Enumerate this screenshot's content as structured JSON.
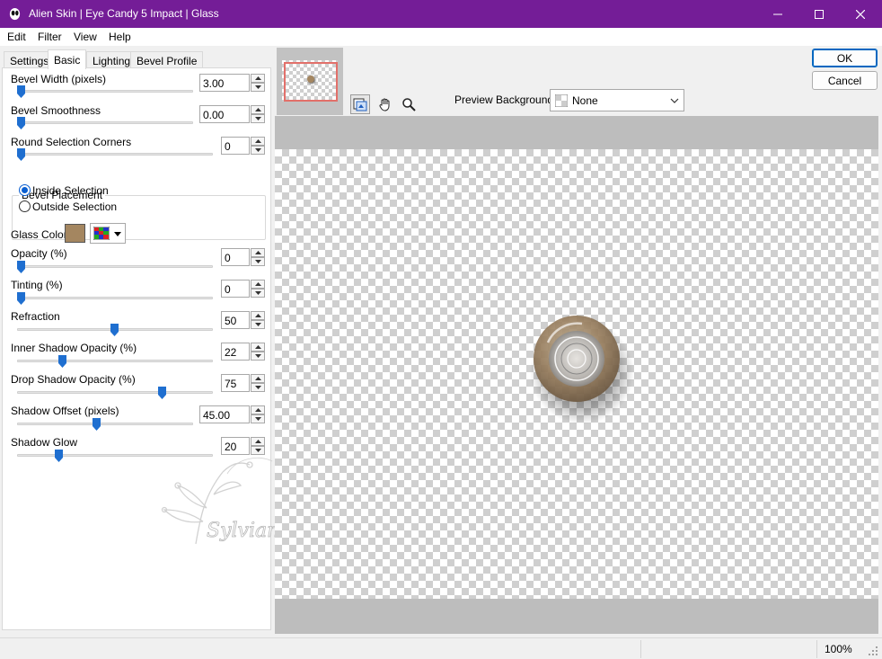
{
  "window": {
    "title": "Alien Skin | Eye Candy 5 Impact | Glass",
    "title_bar_color": "#741d97"
  },
  "menu": [
    "Edit",
    "Filter",
    "View",
    "Help"
  ],
  "tabs": [
    "Settings",
    "Basic",
    "Lighting",
    "Bevel Profile"
  ],
  "active_tab": "Basic",
  "controls": {
    "bevel_width": {
      "label": "Bevel Width (pixels)",
      "value": "3.00",
      "slider_fraction": 0.0
    },
    "bevel_smoothness": {
      "label": "Bevel Smoothness",
      "value": "0.00",
      "slider_fraction": 0.0
    },
    "round_corners": {
      "label": "Round Selection Corners",
      "value": "0",
      "slider_fraction": 0.0
    },
    "bevel_placement": {
      "title": "Bevel Placement",
      "options": [
        "Inside Selection",
        "Outside Selection"
      ],
      "selected": "Inside Selection"
    },
    "glass_color": {
      "label": "Glass Color",
      "color": "#a48660"
    },
    "opacity": {
      "label": "Opacity (%)",
      "value": "0",
      "slider_fraction": 0.0
    },
    "tinting": {
      "label": "Tinting (%)",
      "value": "0",
      "slider_fraction": 0.0
    },
    "refraction": {
      "label": "Refraction",
      "value": "50",
      "slider_fraction": 0.5
    },
    "inner_shadow": {
      "label": "Inner Shadow Opacity (%)",
      "value": "22",
      "slider_fraction": 0.22
    },
    "drop_shadow": {
      "label": "Drop Shadow Opacity (%)",
      "value": "75",
      "slider_fraction": 0.75
    },
    "shadow_offset": {
      "label": "Shadow Offset (pixels)",
      "value": "45.00",
      "slider_fraction": 0.45
    },
    "shadow_glow": {
      "label": "Shadow Glow",
      "value": "20",
      "slider_fraction": 0.2
    }
  },
  "watermark_text": "Sylviane",
  "preview": {
    "background_label": "Preview Background:",
    "background_value": "None"
  },
  "buttons": {
    "ok": "OK",
    "cancel": "Cancel"
  },
  "status": {
    "zoom": "100%"
  },
  "colors": {
    "accent": "#0a5fd1",
    "slider_thumb": "#1f6fd0",
    "nav_rect": "#e2706a"
  }
}
